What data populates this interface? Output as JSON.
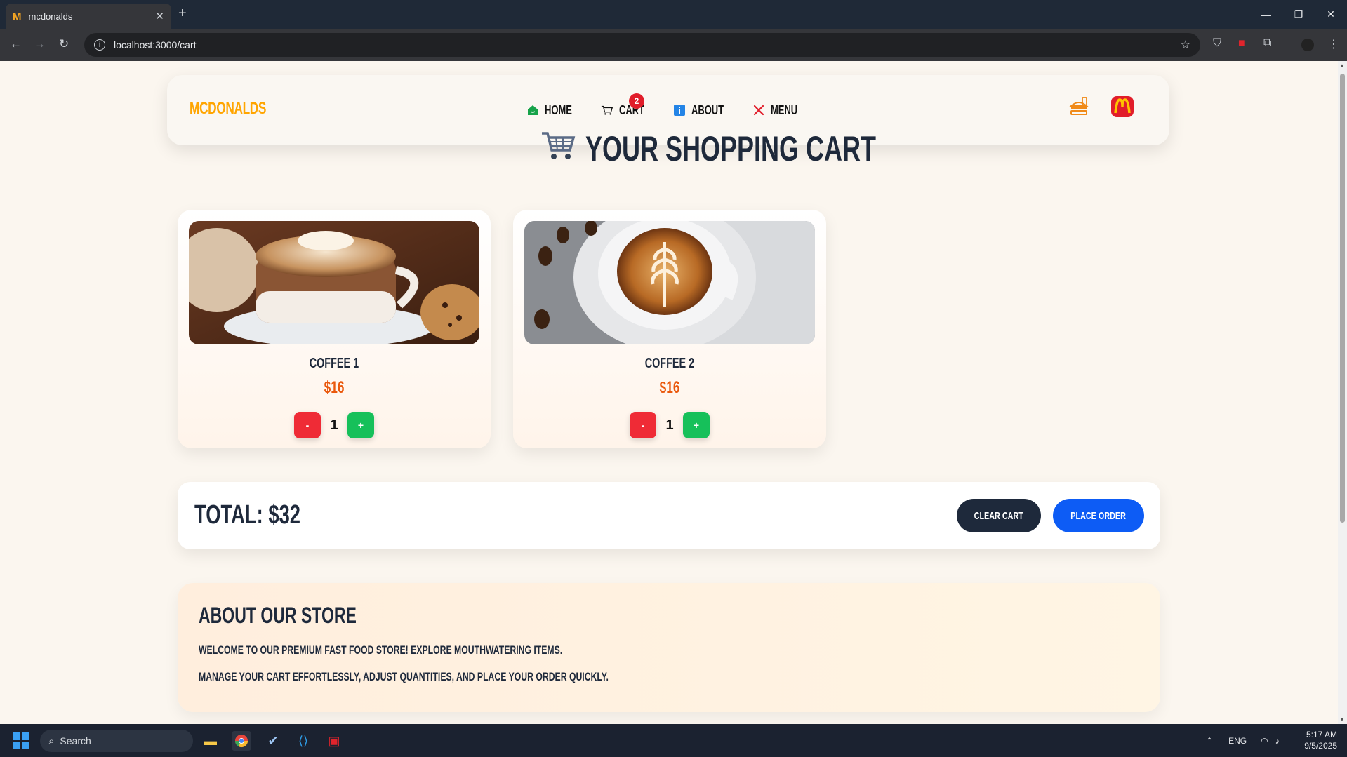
{
  "browser": {
    "tab_title": "mcdonalds",
    "tab_favicon": "M",
    "url": "localhost:3000/cart"
  },
  "header": {
    "brand": "MCDONALDS",
    "nav": [
      {
        "label": "HOME",
        "icon": "home-icon"
      },
      {
        "label": "CART",
        "icon": "cart-icon",
        "badge": "2"
      },
      {
        "label": "ABOUT",
        "icon": "info-icon"
      },
      {
        "label": "MENU",
        "icon": "cutlery-icon"
      }
    ]
  },
  "page": {
    "title": "YOUR SHOPPING CART"
  },
  "cart": {
    "items": [
      {
        "name": "COFFEE 1",
        "price": "$16",
        "quantity": "1",
        "minus": "-",
        "plus": "+"
      },
      {
        "name": "COFFEE 2",
        "price": "$16",
        "quantity": "1",
        "minus": "-",
        "plus": "+"
      }
    ],
    "total_label": "TOTAL: $32",
    "clear_label": "CLEAR CART",
    "order_label": "PLACE ORDER"
  },
  "about": {
    "title": "ABOUT OUR STORE",
    "p1": "WELCOME TO OUR PREMIUM FAST FOOD STORE! EXPLORE MOUTHWATERING ITEMS.",
    "p2": "MANAGE YOUR CART EFFORTLESSLY, ADJUST QUANTITIES, AND PLACE YOUR ORDER QUICKLY."
  },
  "taskbar": {
    "search_placeholder": "Search",
    "lang": "ENG",
    "time": "5:17 AM",
    "date": "9/5/2025"
  },
  "colors": {
    "brand": "#ffa500",
    "price": "#ea580c",
    "minus": "#ef2b36",
    "plus": "#16c05a",
    "clear": "#1e293b",
    "order": "#0d5cf5",
    "badge": "#e11d2a"
  }
}
